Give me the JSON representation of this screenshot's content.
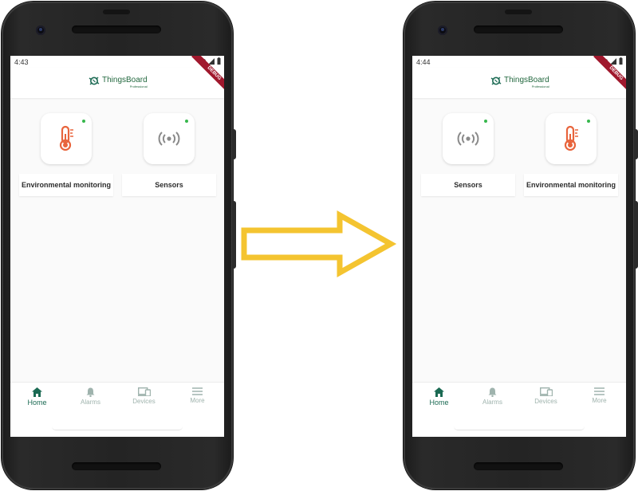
{
  "colors": {
    "primary": "#1b6a53",
    "inactive_nav": "#9fb3ad",
    "thermometer": "#e8643c",
    "sensor_icon": "#8a8a8a",
    "online_dot": "#37b74d",
    "arrow": "#f4c430",
    "debug_ribbon": "#a0182d"
  },
  "app": {
    "logo_text": "ThingsBoard",
    "logo_subtitle": "Professional",
    "debug_label": "DEBUG"
  },
  "navigation": {
    "home": "Home",
    "alarms": "Alarms",
    "devices": "Devices",
    "more": "More"
  },
  "screens": {
    "before": {
      "time": "4:43",
      "tiles": [
        {
          "label": "Environmental monitoring",
          "icon": "thermometer-icon"
        },
        {
          "label": "Sensors",
          "icon": "sensor-icon"
        }
      ]
    },
    "after": {
      "time": "4:44",
      "tiles": [
        {
          "label": "Sensors",
          "icon": "sensor-icon"
        },
        {
          "label": "Environmental monitoring",
          "icon": "thermometer-icon"
        }
      ]
    }
  }
}
